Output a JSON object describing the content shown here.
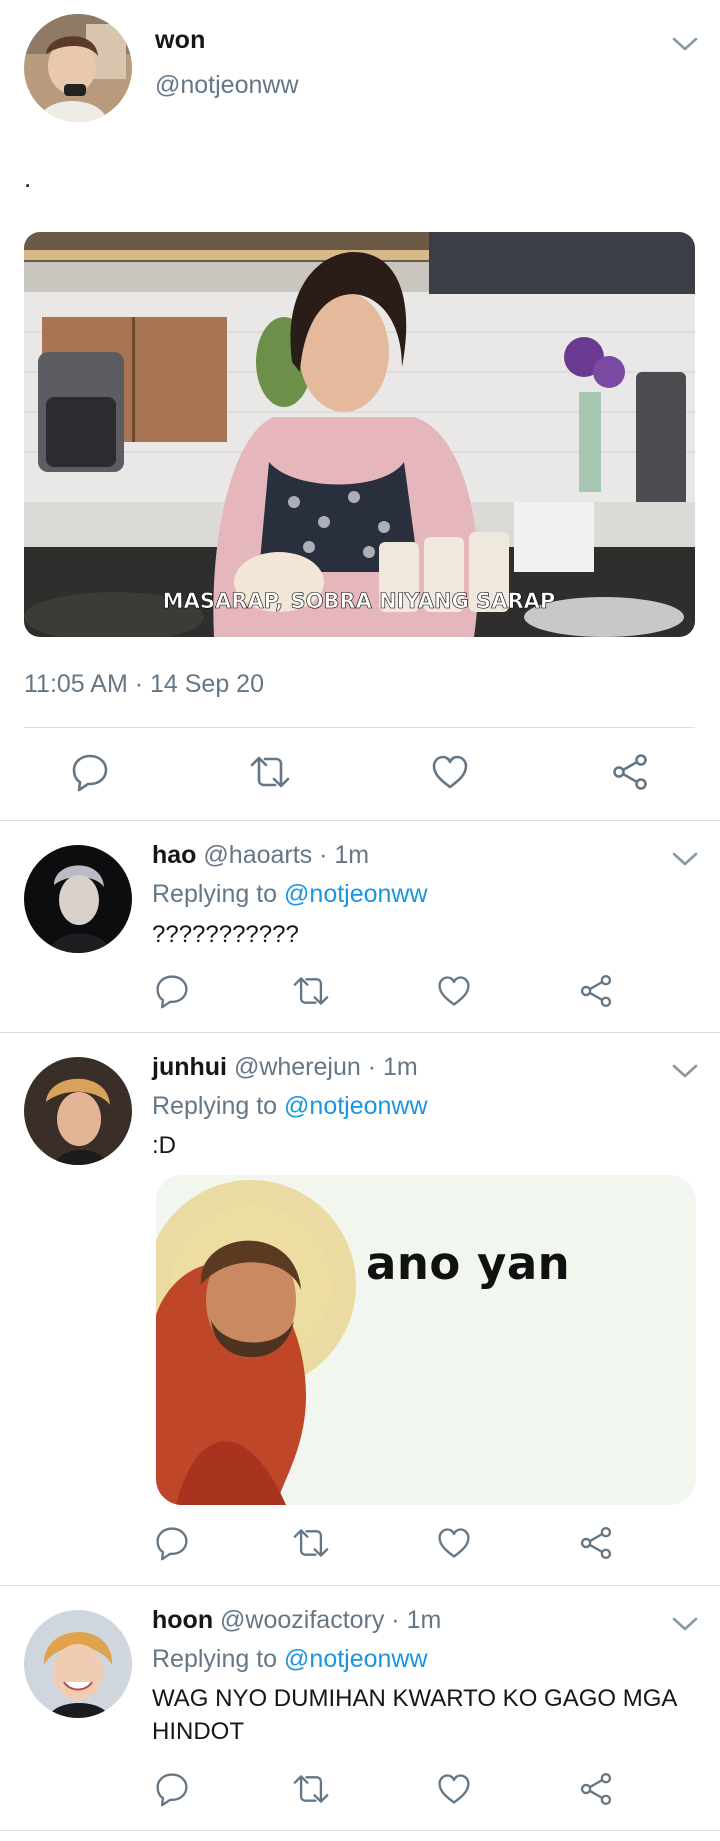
{
  "main_tweet": {
    "name": "won",
    "handle": "@notjeonww",
    "text": ".",
    "media_caption": "MASARAP, SOBRA NIYANG SARAP",
    "timestamp": "11:05 AM · 14 Sep 20"
  },
  "replies": [
    {
      "name": "hao",
      "meta": "@haoarts · 1m",
      "replying_prefix": "Replying to",
      "replying_to": "@notjeonww",
      "text": "???????????"
    },
    {
      "name": "junhui",
      "meta": "@wherejun · 1m",
      "replying_prefix": "Replying to",
      "replying_to": "@notjeonww",
      "text": ":D",
      "media_caption": "ano yan"
    },
    {
      "name": "hoon",
      "meta": "@woozifactory · 1m",
      "replying_prefix": "Replying to",
      "replying_to": "@notjeonww",
      "text": "WAG NYO DUMIHAN KWARTO KO GAGO MGA HINDOT"
    }
  ],
  "icons": [
    "chevron-down-icon",
    "reply-icon",
    "retweet-icon",
    "like-icon",
    "share-icon"
  ],
  "colors": {
    "link": "#1b95e0",
    "muted": "#657786",
    "icon": "#657786",
    "divider": "#d9dee3"
  }
}
